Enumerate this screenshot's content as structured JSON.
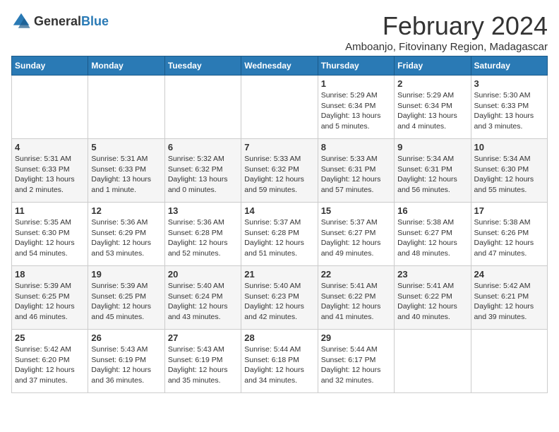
{
  "logo": {
    "general": "General",
    "blue": "Blue"
  },
  "header": {
    "month_year": "February 2024",
    "location": "Amboanjo, Fitovinany Region, Madagascar"
  },
  "days_of_week": [
    "Sunday",
    "Monday",
    "Tuesday",
    "Wednesday",
    "Thursday",
    "Friday",
    "Saturday"
  ],
  "weeks": [
    [
      {
        "day": "",
        "info": ""
      },
      {
        "day": "",
        "info": ""
      },
      {
        "day": "",
        "info": ""
      },
      {
        "day": "",
        "info": ""
      },
      {
        "day": "1",
        "info": "Sunrise: 5:29 AM\nSunset: 6:34 PM\nDaylight: 13 hours and 5 minutes."
      },
      {
        "day": "2",
        "info": "Sunrise: 5:29 AM\nSunset: 6:34 PM\nDaylight: 13 hours and 4 minutes."
      },
      {
        "day": "3",
        "info": "Sunrise: 5:30 AM\nSunset: 6:33 PM\nDaylight: 13 hours and 3 minutes."
      }
    ],
    [
      {
        "day": "4",
        "info": "Sunrise: 5:31 AM\nSunset: 6:33 PM\nDaylight: 13 hours and 2 minutes."
      },
      {
        "day": "5",
        "info": "Sunrise: 5:31 AM\nSunset: 6:33 PM\nDaylight: 13 hours and 1 minute."
      },
      {
        "day": "6",
        "info": "Sunrise: 5:32 AM\nSunset: 6:32 PM\nDaylight: 13 hours and 0 minutes."
      },
      {
        "day": "7",
        "info": "Sunrise: 5:33 AM\nSunset: 6:32 PM\nDaylight: 12 hours and 59 minutes."
      },
      {
        "day": "8",
        "info": "Sunrise: 5:33 AM\nSunset: 6:31 PM\nDaylight: 12 hours and 57 minutes."
      },
      {
        "day": "9",
        "info": "Sunrise: 5:34 AM\nSunset: 6:31 PM\nDaylight: 12 hours and 56 minutes."
      },
      {
        "day": "10",
        "info": "Sunrise: 5:34 AM\nSunset: 6:30 PM\nDaylight: 12 hours and 55 minutes."
      }
    ],
    [
      {
        "day": "11",
        "info": "Sunrise: 5:35 AM\nSunset: 6:30 PM\nDaylight: 12 hours and 54 minutes."
      },
      {
        "day": "12",
        "info": "Sunrise: 5:36 AM\nSunset: 6:29 PM\nDaylight: 12 hours and 53 minutes."
      },
      {
        "day": "13",
        "info": "Sunrise: 5:36 AM\nSunset: 6:28 PM\nDaylight: 12 hours and 52 minutes."
      },
      {
        "day": "14",
        "info": "Sunrise: 5:37 AM\nSunset: 6:28 PM\nDaylight: 12 hours and 51 minutes."
      },
      {
        "day": "15",
        "info": "Sunrise: 5:37 AM\nSunset: 6:27 PM\nDaylight: 12 hours and 49 minutes."
      },
      {
        "day": "16",
        "info": "Sunrise: 5:38 AM\nSunset: 6:27 PM\nDaylight: 12 hours and 48 minutes."
      },
      {
        "day": "17",
        "info": "Sunrise: 5:38 AM\nSunset: 6:26 PM\nDaylight: 12 hours and 47 minutes."
      }
    ],
    [
      {
        "day": "18",
        "info": "Sunrise: 5:39 AM\nSunset: 6:25 PM\nDaylight: 12 hours and 46 minutes."
      },
      {
        "day": "19",
        "info": "Sunrise: 5:39 AM\nSunset: 6:25 PM\nDaylight: 12 hours and 45 minutes."
      },
      {
        "day": "20",
        "info": "Sunrise: 5:40 AM\nSunset: 6:24 PM\nDaylight: 12 hours and 43 minutes."
      },
      {
        "day": "21",
        "info": "Sunrise: 5:40 AM\nSunset: 6:23 PM\nDaylight: 12 hours and 42 minutes."
      },
      {
        "day": "22",
        "info": "Sunrise: 5:41 AM\nSunset: 6:22 PM\nDaylight: 12 hours and 41 minutes."
      },
      {
        "day": "23",
        "info": "Sunrise: 5:41 AM\nSunset: 6:22 PM\nDaylight: 12 hours and 40 minutes."
      },
      {
        "day": "24",
        "info": "Sunrise: 5:42 AM\nSunset: 6:21 PM\nDaylight: 12 hours and 39 minutes."
      }
    ],
    [
      {
        "day": "25",
        "info": "Sunrise: 5:42 AM\nSunset: 6:20 PM\nDaylight: 12 hours and 37 minutes."
      },
      {
        "day": "26",
        "info": "Sunrise: 5:43 AM\nSunset: 6:19 PM\nDaylight: 12 hours and 36 minutes."
      },
      {
        "day": "27",
        "info": "Sunrise: 5:43 AM\nSunset: 6:19 PM\nDaylight: 12 hours and 35 minutes."
      },
      {
        "day": "28",
        "info": "Sunrise: 5:44 AM\nSunset: 6:18 PM\nDaylight: 12 hours and 34 minutes."
      },
      {
        "day": "29",
        "info": "Sunrise: 5:44 AM\nSunset: 6:17 PM\nDaylight: 12 hours and 32 minutes."
      },
      {
        "day": "",
        "info": ""
      },
      {
        "day": "",
        "info": ""
      }
    ]
  ]
}
